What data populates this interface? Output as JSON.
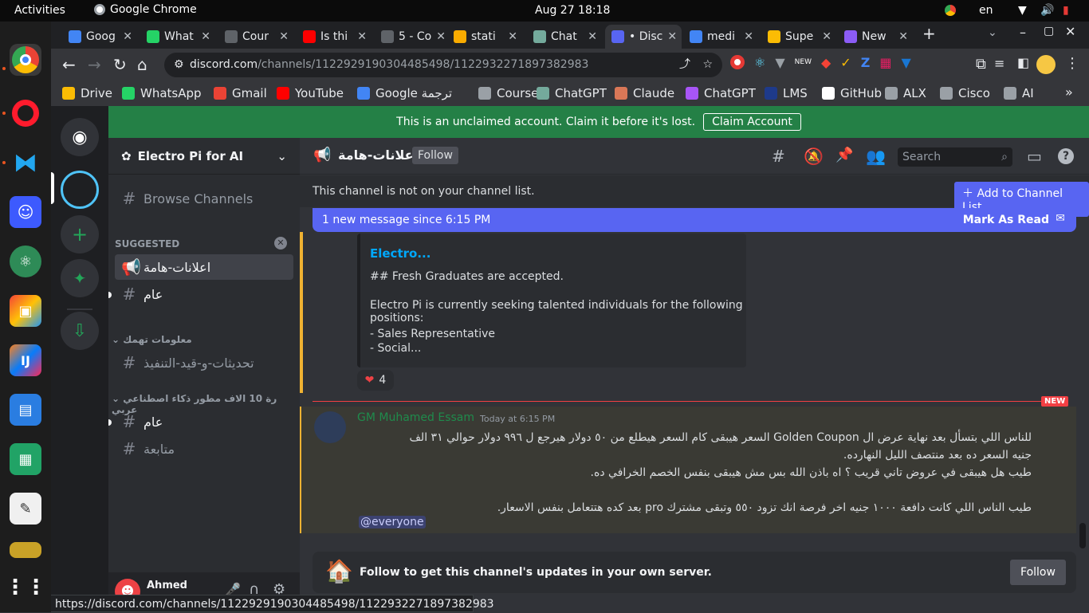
{
  "system": {
    "activities": "Activities",
    "app_name": "Google Chrome",
    "datetime": "Aug 27  18:18",
    "lang": "en"
  },
  "tabs": [
    {
      "label": "Goog",
      "color": "#4285f4"
    },
    {
      "label": "What",
      "color": "#25d366"
    },
    {
      "label": "Cour",
      "color": "#5f6368"
    },
    {
      "label": "Is thi",
      "color": "#ff0000"
    },
    {
      "label": "5 - Co",
      "color": "#5f6368"
    },
    {
      "label": "stati",
      "color": "#f9ab00"
    },
    {
      "label": "Chat",
      "color": "#74aa9c"
    },
    {
      "label": "• Disc",
      "color": "#5865f2"
    },
    {
      "label": "medi",
      "color": "#4285f4"
    },
    {
      "label": "Supe",
      "color": "#fbbc04"
    },
    {
      "label": "New",
      "color": "#8b5cf6"
    }
  ],
  "url": {
    "host": "discord.com",
    "path": "/channels/1122929190304485498/1122932271897382983"
  },
  "bookmarks": [
    {
      "label": "Drive",
      "color": "#fbbc04"
    },
    {
      "label": "WhatsApp",
      "color": "#25d366"
    },
    {
      "label": "Gmail",
      "color": "#ea4335"
    },
    {
      "label": "YouTube",
      "color": "#ff0000"
    },
    {
      "label": "Google ترجمة",
      "color": "#4285f4"
    },
    {
      "label": "Courses",
      "color": "#9aa0a6"
    },
    {
      "label": "ChatGPT",
      "color": "#74aa9c"
    },
    {
      "label": "Claude",
      "color": "#d97757"
    },
    {
      "label": "ChatGPT",
      "color": "#a855f7"
    },
    {
      "label": "LMS",
      "color": "#1e3a8a"
    },
    {
      "label": "GitHub",
      "color": "#ffffff"
    },
    {
      "label": "ALX",
      "color": "#9aa0a6"
    },
    {
      "label": "Cisco",
      "color": "#9aa0a6"
    },
    {
      "label": "AI",
      "color": "#9aa0a6"
    }
  ],
  "banner": {
    "text": "This is an unclaimed account. Claim it before it's lost.",
    "button": "Claim Account"
  },
  "server": {
    "name": "Electro Pi for AI",
    "browse": "Browse Channels",
    "suggested_label": "SUGGESTED",
    "suggested": [
      "اعلانات-هامة",
      "عام"
    ],
    "cat1": "معلومات تهمك",
    "cat1_channels": [
      "تحديثات-و-قيد-التنفيذ"
    ],
    "cat2": "رة 10 الاف مطور ذكاء اصطناعي عربي",
    "cat2_channels": [
      "عام",
      "متابعة"
    ]
  },
  "header": {
    "channel": "اعلانات-هامة",
    "follow": "Follow",
    "search_placeholder": "Search"
  },
  "notice": {
    "text": "This channel is not on your channel list.",
    "button": "Add to Channel List"
  },
  "newbar": {
    "text": "1 new message since 6:15 PM",
    "action": "Mark As Read"
  },
  "embed": {
    "title": "Electro...",
    "line1": "## Fresh Graduates are accepted.",
    "line2": "Electro Pi is currently seeking talented individuals for the following positions:",
    "line3": "- Sales Representative",
    "line4": "- Social..."
  },
  "reaction": {
    "emoji": "❤",
    "count": "4"
  },
  "new_label": "NEW",
  "message": {
    "author": "GM Muhamed Essam",
    "time": "Today at 6:15 PM",
    "p1a": "للناس اللي بتسأل بعد نهاية عرض ال Golden Coupon السعر هيبقى كام السعر هيطلع من ٥٠ دولار هيرجع ل ٩٩٦ دولار حوالي ٣١ الف",
    "p1b": "جنيه السعر ده بعد منتصف الليل النهارده.",
    "p2": "طيب هل هيبقى في عروض تاني قريب ؟ اه باذن الله بس مش هيبقى بنفس الخصم الخرافي ده.",
    "p3": "طيب الناس اللي كانت دافعة ١٠٠٠ جنيه اخر فرصة انك تزود ٥٥٠ وتبقى مشترك pro بعد كده هتتعامل بنفس الاسعار.",
    "mention": "@everyone"
  },
  "followbar": {
    "text": "Follow to get this channel's updates in your own server.",
    "button": "Follow"
  },
  "user": {
    "name": "Ahmed"
  },
  "status_url": "https://discord.com/channels/1122929190304485498/1122932271897382983"
}
